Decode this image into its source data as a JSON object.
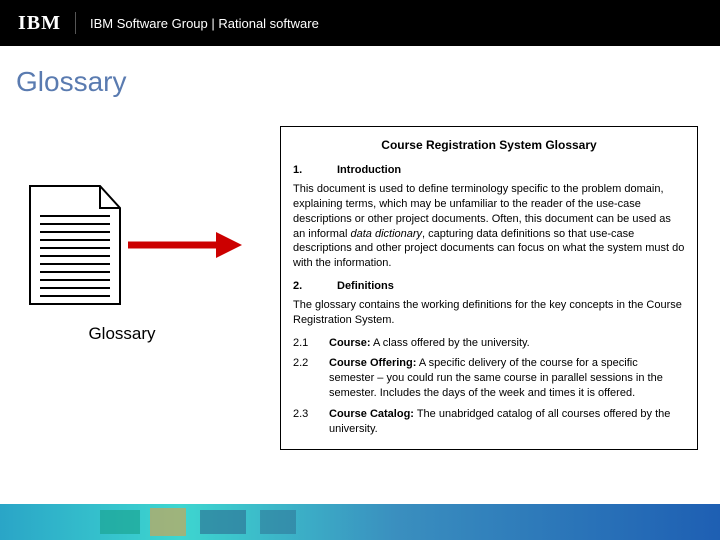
{
  "header": {
    "logo": "IBM",
    "text": "IBM Software Group | Rational software"
  },
  "page_title": "Glossary",
  "left": {
    "doc_label": "Glossary"
  },
  "box": {
    "title": "Course Registration System Glossary",
    "sec1_num": "1.",
    "sec1_heading": "Introduction",
    "intro_prefix": "This document is used to define terminology specific to the problem domain, explaining terms, which may be unfamiliar to the reader of the use-case descriptions or other project documents.  Often, this document can be used as an informal ",
    "intro_italic": "data dictionary",
    "intro_suffix": ", capturing data definitions so that use-case descriptions and other project documents can focus on what the system must do with the information.",
    "sec2_num": "2.",
    "sec2_heading": "Definitions",
    "defs_intro": "The glossary contains the working definitions for the key concepts in the Course Registration System.",
    "d21_num": "2.1",
    "d21_term": "Course:",
    "d21_text": " A class offered by the university.",
    "d22_num": "2.2",
    "d22_term": "Course Offering:",
    "d22_text": " A specific delivery of the course for a specific semester – you could run the same course in parallel sessions in the semester. Includes the days of the week and times it is offered.",
    "d23_num": "2.3",
    "d23_term": "Course Catalog:",
    "d23_text": " The unabridged catalog of all courses offered by the university."
  }
}
